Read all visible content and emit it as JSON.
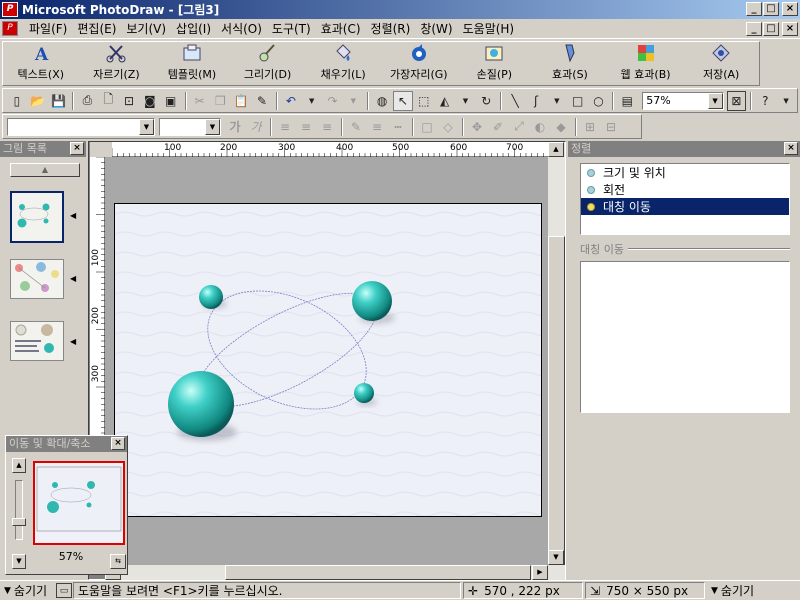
{
  "window": {
    "title": "Microsoft PhotoDraw - [그림3]",
    "min": "_",
    "max": "□",
    "close": "×"
  },
  "menu": [
    "파일(F)",
    "편집(E)",
    "보기(V)",
    "삽입(I)",
    "서식(O)",
    "도구(T)",
    "효과(C)",
    "정렬(R)",
    "창(W)",
    "도움말(H)"
  ],
  "big_toolbar": [
    {
      "label": "텍스트(X)",
      "icon": "text-icon"
    },
    {
      "label": "자르기(Z)",
      "icon": "scissors-icon"
    },
    {
      "label": "템플릿(M)",
      "icon": "template-icon"
    },
    {
      "label": "그리기(D)",
      "icon": "brush-icon"
    },
    {
      "label": "채우기(L)",
      "icon": "fill-icon"
    },
    {
      "label": "가장자리(G)",
      "icon": "edge-icon"
    },
    {
      "label": "손질(P)",
      "icon": "touchup-icon"
    },
    {
      "label": "효과(S)",
      "icon": "effects-icon"
    },
    {
      "label": "웹 효과(B)",
      "icon": "web-effects-icon"
    },
    {
      "label": "저장(A)",
      "icon": "save-icon"
    }
  ],
  "toolbar": {
    "zoom_value": "57%",
    "font_value": "",
    "size_value": ""
  },
  "picture_list": {
    "title": "그림 목록",
    "close": "×"
  },
  "rulers": {
    "h_ticks": [
      "100",
      "200",
      "300",
      "400",
      "500",
      "600",
      "700"
    ],
    "v_ticks": [
      "100",
      "200",
      "300"
    ]
  },
  "pan_zoom": {
    "title": "이동 및 확대/축소",
    "close": "×",
    "zoom": "57%"
  },
  "arrange_panel": {
    "title": "정렬",
    "close": "×",
    "items": [
      "크기 및 위치",
      "회전",
      "대칭 이동"
    ],
    "selected_index": 2,
    "section_label": "대칭 이동"
  },
  "status": {
    "hide_left": "숨기기",
    "help": "도움말을 보려면 <F1>키를 누르십시오.",
    "coords": "570 , 222  px",
    "size": "750 × 550  px",
    "hide_right": "숨기기"
  },
  "colors": {
    "titlebar_start": "#0a246a",
    "titlebar_end": "#a6caf0",
    "sphere": "#40c8c0",
    "selection": "#0a246a",
    "panzoom_frame": "#dd0000"
  }
}
